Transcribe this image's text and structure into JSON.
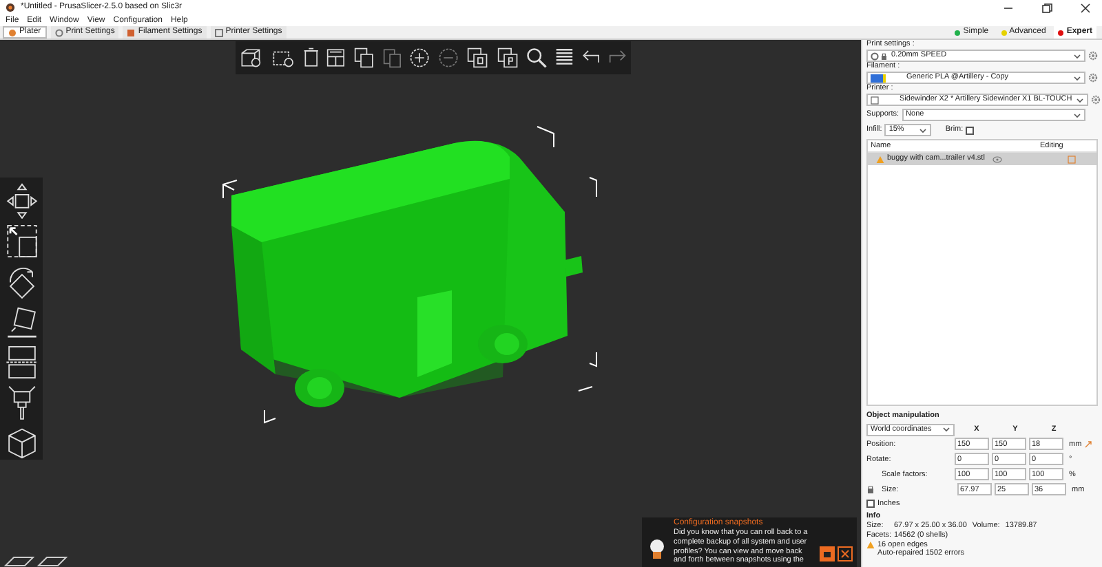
{
  "window": {
    "title": "*Untitled - PrusaSlicer-2.5.0 based on Slic3r"
  },
  "menu": [
    "File",
    "Edit",
    "Window",
    "View",
    "Configuration",
    "Help"
  ],
  "tabs": [
    {
      "label": "Plater",
      "selected": true
    },
    {
      "label": "Print Settings",
      "selected": false
    },
    {
      "label": "Filament Settings",
      "selected": false
    },
    {
      "label": "Printer Settings",
      "selected": false
    }
  ],
  "modes": [
    {
      "label": "Simple",
      "color": "#22b14c",
      "selected": false
    },
    {
      "label": "Advanced",
      "color": "#e6d200",
      "selected": false
    },
    {
      "label": "Expert",
      "color": "#e01010",
      "selected": true
    }
  ],
  "sidebar": {
    "print_label": "Print settings :",
    "print_value": "0.20mm SPEED",
    "filament_label": "Filament :",
    "filament_value": "Generic PLA @Artillery - Copy",
    "filament_swatch": {
      "color": "#2f6fd8"
    },
    "printer_label": "Printer :",
    "printer_value": "Sidewinder X2 * Artillery Sidewinder X1 BL-TOUCH",
    "supports_label": "Supports:",
    "supports_value": "None",
    "infill_label": "Infill:",
    "infill_value": "15%",
    "brim_label": "Brim:",
    "brim_checked": false,
    "objects": {
      "columns": [
        "Name",
        "Editing"
      ],
      "rows": [
        {
          "name": "buggy with cam...trailer v4.stl",
          "warning": true,
          "selected": true
        }
      ]
    },
    "manipulation": {
      "title": "Object manipulation",
      "coordinates": "World coordinates",
      "axes": [
        "X",
        "Y",
        "Z"
      ],
      "rows": [
        {
          "label": "Position:",
          "values": [
            "150",
            "150",
            "18"
          ],
          "unit": "mm"
        },
        {
          "label": "Rotate:",
          "values": [
            "0",
            "0",
            "0"
          ],
          "unit": "°"
        },
        {
          "label": "Scale factors:",
          "values": [
            "100",
            "100",
            "100"
          ],
          "unit": "%"
        },
        {
          "label": "Size:",
          "values": [
            "67.97",
            "25",
            "36"
          ],
          "unit": "mm"
        }
      ],
      "inches_label": "Inches",
      "inches_checked": false
    },
    "info": {
      "title": "Info",
      "size_label": "Size:",
      "size_value": "67.97 x 25.00 x 36.00",
      "volume_label": "Volume:",
      "volume_value": "13789.87",
      "facets_label": "Facets:",
      "facets_value": "14562 (0 shells)",
      "warnings": [
        "16 open edges",
        "Auto-repaired 1502 errors"
      ]
    }
  },
  "notification": {
    "title": "Configuration snapshots",
    "text": "Did you know that you can roll back to a complete backup of all system and user profiles? You can view and move back and forth between snapshots using the"
  }
}
